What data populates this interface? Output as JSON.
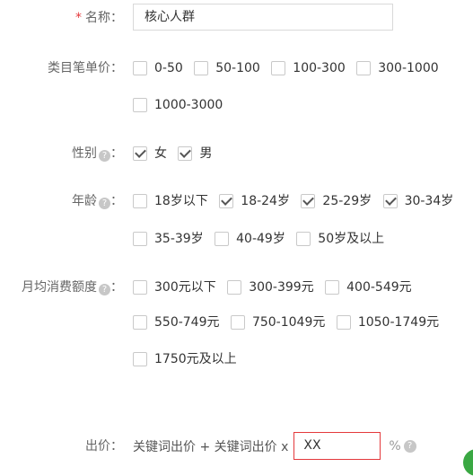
{
  "name_field": {
    "label": "名称：",
    "required_mark": "*",
    "value": "核心人群"
  },
  "category_price": {
    "label": "类目笔单价：",
    "options": [
      {
        "text": "0-50",
        "checked": false
      },
      {
        "text": "50-100",
        "checked": false
      },
      {
        "text": "100-300",
        "checked": false
      },
      {
        "text": "300-1000",
        "checked": false
      },
      {
        "text": "1000-3000",
        "checked": false
      }
    ]
  },
  "gender": {
    "label": "性别",
    "suffix": "：",
    "help_glyph": "?",
    "options": [
      {
        "text": "女",
        "checked": true
      },
      {
        "text": "男",
        "checked": true
      }
    ]
  },
  "age": {
    "label": "年龄",
    "suffix": "：",
    "help_glyph": "?",
    "options": [
      {
        "text": "18岁以下",
        "checked": false
      },
      {
        "text": "18-24岁",
        "checked": true
      },
      {
        "text": "25-29岁",
        "checked": true
      },
      {
        "text": "30-34岁",
        "checked": true
      },
      {
        "text": "35-39岁",
        "checked": false
      },
      {
        "text": "40-49岁",
        "checked": false
      },
      {
        "text": "50岁及以上",
        "checked": false
      }
    ]
  },
  "monthly_spend": {
    "label": "月均消费额度",
    "suffix": "：",
    "help_glyph": "?",
    "options": [
      {
        "text": "300元以下",
        "checked": false
      },
      {
        "text": "300-399元",
        "checked": false
      },
      {
        "text": "400-549元",
        "checked": false
      },
      {
        "text": "550-749元",
        "checked": false
      },
      {
        "text": "750-1049元",
        "checked": false
      },
      {
        "text": "1050-1749元",
        "checked": false
      },
      {
        "text": "1750元及以上",
        "checked": false
      }
    ]
  },
  "bid": {
    "label": "出价：",
    "formula": "关键词出价 + 关键词出价 x",
    "value": "XX",
    "unit": "%",
    "help_glyph": "?"
  },
  "colors": {
    "required": "#e4393c",
    "input_error_border": "#e4393c",
    "corner_badge": "#3aa843"
  }
}
